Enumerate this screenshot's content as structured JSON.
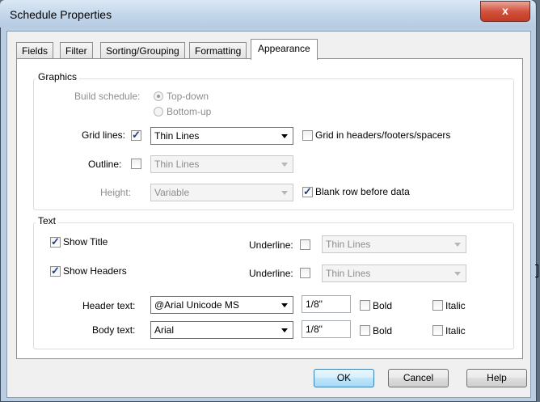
{
  "window": {
    "title": "Schedule Properties",
    "close_glyph": "x"
  },
  "tabs": [
    "Fields",
    "Filter",
    "Sorting/Grouping",
    "Formatting",
    "Appearance"
  ],
  "active_tab": "Appearance",
  "graphics": {
    "legend": "Graphics",
    "build_schedule_label": "Build schedule:",
    "build_options": [
      "Top-down",
      "Bottom-up"
    ],
    "grid_lines_label": "Grid lines:",
    "grid_lines_checked": true,
    "grid_lines_value": "Thin Lines",
    "grid_headers_label": "Grid in headers/footers/spacers",
    "grid_headers_checked": false,
    "outline_label": "Outline:",
    "outline_checked": false,
    "outline_value": "Thin Lines",
    "height_label": "Height:",
    "height_value": "Variable",
    "blank_row_label": "Blank row before data",
    "blank_row_checked": true
  },
  "text": {
    "legend": "Text",
    "show_title_label": "Show Title",
    "show_title_checked": true,
    "show_headers_label": "Show Headers",
    "show_headers_checked": true,
    "underline_label": "Underline:",
    "title_underline_value": "Thin Lines",
    "headers_underline_value": "Thin Lines",
    "header_text_label": "Header text:",
    "header_font": "@Arial Unicode MS",
    "header_size": "1/8\"",
    "body_text_label": "Body text:",
    "body_font": "Arial",
    "body_size": "1/8\"",
    "bold_label": "Bold",
    "italic_label": "Italic"
  },
  "buttons": {
    "ok": "OK",
    "cancel": "Cancel",
    "help": "Help"
  },
  "colors": {
    "accent": "#3c7fb1",
    "close": "#c13b24",
    "tick": "#1a3f8a"
  }
}
